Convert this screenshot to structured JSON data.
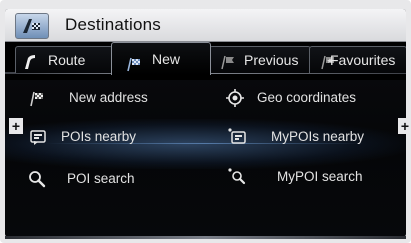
{
  "header": {
    "title": "Destinations",
    "app_icon": "navigation-flag-icon"
  },
  "tabs": [
    {
      "label": "Route",
      "icon": "route-icon",
      "active": false
    },
    {
      "label": "New",
      "icon": "checkered-flag-icon",
      "active": true
    },
    {
      "label": "Previous",
      "icon": "previous-flag-icon",
      "active": false
    },
    {
      "label": "Favourites",
      "icon": "favourites-flag-icon",
      "active": false
    }
  ],
  "menu": {
    "new_address": "New address",
    "geo_coordinates": "Geo coordinates",
    "pois_nearby": "POIs nearby",
    "mypois_nearby": "MyPOIs nearby",
    "poi_search": "POI search",
    "mypoi_search": "MyPOI search"
  },
  "side_buttons": {
    "left": "+",
    "right": "+"
  },
  "colors": {
    "highlight": "#5c8cc8",
    "text": "#e2e2e2",
    "titlebar": "#e4e5e8"
  }
}
